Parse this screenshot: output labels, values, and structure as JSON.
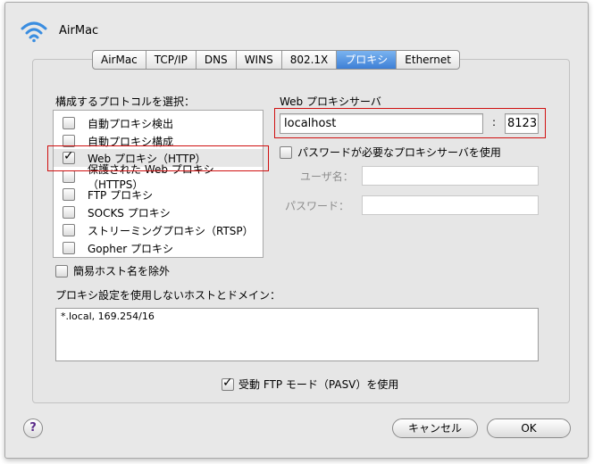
{
  "header": {
    "title": "AirMac",
    "icon": "wifi-icon"
  },
  "tabs": [
    {
      "label": "AirMac",
      "selected": false
    },
    {
      "label": "TCP/IP",
      "selected": false
    },
    {
      "label": "DNS",
      "selected": false
    },
    {
      "label": "WINS",
      "selected": false
    },
    {
      "label": "802.1X",
      "selected": false
    },
    {
      "label": "プロキシ",
      "selected": true
    },
    {
      "label": "Ethernet",
      "selected": false
    }
  ],
  "protocols": {
    "heading": "構成するプロトコルを選択：",
    "items": [
      {
        "label": "自動プロキシ検出",
        "checked": false
      },
      {
        "label": "自動プロキシ構成",
        "checked": false
      },
      {
        "label": "Web プロキシ（HTTP）",
        "checked": true
      },
      {
        "label": "保護された Web プロキシ（HTTPS）",
        "checked": false
      },
      {
        "label": "FTP プロキシ",
        "checked": false
      },
      {
        "label": "SOCKS プロキシ",
        "checked": false
      },
      {
        "label": "ストリーミングプロキシ（RTSP）",
        "checked": false
      },
      {
        "label": "Gopher プロキシ",
        "checked": false
      }
    ]
  },
  "proxy_server": {
    "heading": "Web プロキシサーバ",
    "host": "localhost",
    "colon": ":",
    "port": "8123",
    "password_required_label": "パスワードが必要なプロキシサーバを使用",
    "username_label": "ユーザ名：",
    "password_label": "パスワード："
  },
  "exclude_simple_hostnames_label": "簡易ホスト名を除外",
  "bypass": {
    "heading": "プロキシ設定を使用しないホストとドメイン：",
    "value": "*.local, 169.254/16"
  },
  "passive_ftp_label": "受動 FTP モード（PASV）を使用",
  "buttons": {
    "help": "?",
    "cancel": "キャンセル",
    "ok": "OK"
  },
  "colors": {
    "highlight_border": "#d01010",
    "selected_tab": "#3d7fd6"
  }
}
